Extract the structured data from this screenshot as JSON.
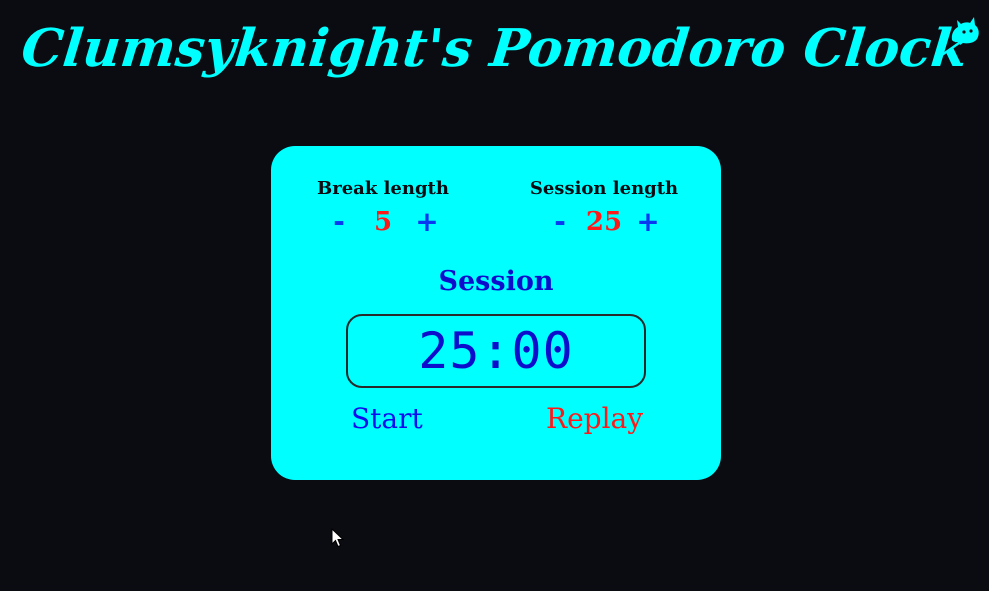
{
  "header": {
    "title": "Clumsyknight's Pomodoro Clock"
  },
  "corner_icon": "cat-icon",
  "panel": {
    "break": {
      "label": "Break length",
      "decrement": "-",
      "value": "5",
      "increment": "+"
    },
    "session": {
      "label": "Session length",
      "decrement": "-",
      "value": "25",
      "increment": "+"
    },
    "mode_label": "Session",
    "timer": "25:00",
    "start_label": "Start",
    "replay_label": "Replay"
  },
  "colors": {
    "background": "#0b0b12",
    "accent": "#00ffff",
    "blue": "#0d0dcc",
    "red": "#ff1a1a"
  }
}
